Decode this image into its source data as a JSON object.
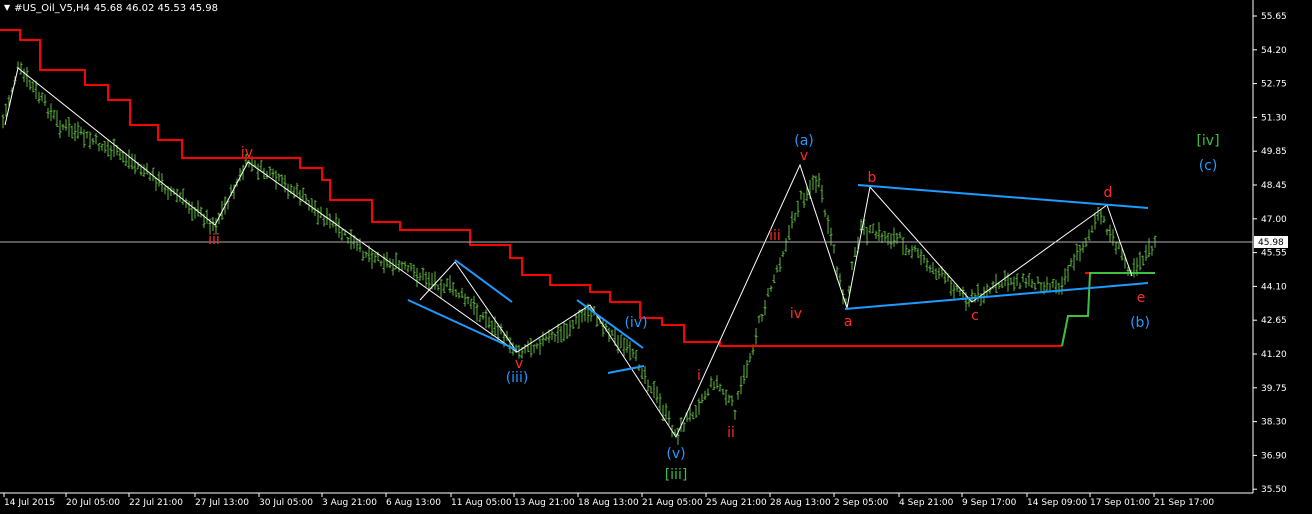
{
  "header": {
    "dropdown_glyph": "▼",
    "symbol": "#US_Oil_V5,H4",
    "ohlc": "45.68 46.02 45.53 45.98"
  },
  "colors": {
    "background": "#000000",
    "bars": "#5eb83b",
    "axis": "#ffffff",
    "red_line": "#ff0000",
    "green_line": "#3fbf3f",
    "wave_white": "#ffffff",
    "channel_blue": "#1e9bff",
    "label_red": "#ff2a2a",
    "label_blue": "#1e9bff",
    "label_green": "#3fbf3f",
    "price_line": "#b0b0b0",
    "price_box_bg": "#ffffff",
    "price_box_fg": "#000000"
  },
  "price_axis": {
    "ticks": [
      "55.65",
      "54.20",
      "52.75",
      "51.30",
      "49.85",
      "48.45",
      "47.00",
      "45.55",
      "44.10",
      "42.65",
      "41.20",
      "39.75",
      "38.30",
      "36.90",
      "35.50"
    ],
    "current_price": "45.98"
  },
  "time_axis": {
    "ticks": [
      "14 Jul 2015",
      "20 Jul 05:00",
      "22 Jul 21:00",
      "27 Jul 13:00",
      "30 Jul 05:00",
      "3 Aug 21:00",
      "6 Aug 13:00",
      "11 Aug 05:00",
      "13 Aug 21:00",
      "18 Aug 13:00",
      "21 Aug 05:00",
      "25 Aug 21:00",
      "28 Aug 13:00",
      "2 Sep 05:00",
      "4 Sep 21:00",
      "9 Sep 17:00",
      "14 Sep 09:00",
      "17 Sep 01:00",
      "21 Sep 17:00"
    ]
  },
  "wave_labels": [
    {
      "id": "iv-top",
      "text": "iv",
      "color": "red"
    },
    {
      "id": "iii-low",
      "text": "iii",
      "color": "red"
    },
    {
      "id": "v-low",
      "text": "v",
      "color": "red"
    },
    {
      "id": "iii-paren",
      "text": "(iii)",
      "color": "blue"
    },
    {
      "id": "iv-paren",
      "text": "(iv)",
      "color": "blue"
    },
    {
      "id": "v-paren",
      "text": "(v)",
      "color": "blue"
    },
    {
      "id": "iii-bracket",
      "text": "[iii]",
      "color": "green"
    },
    {
      "id": "i-red",
      "text": "i",
      "color": "red"
    },
    {
      "id": "ii-red",
      "text": "ii",
      "color": "red"
    },
    {
      "id": "iii-red2",
      "text": "iii",
      "color": "red"
    },
    {
      "id": "iv-red2",
      "text": "iv",
      "color": "red"
    },
    {
      "id": "v-red2",
      "text": "v",
      "color": "red"
    },
    {
      "id": "a-paren",
      "text": "(a)",
      "color": "blue"
    },
    {
      "id": "a-red",
      "text": "a",
      "color": "red"
    },
    {
      "id": "b-red",
      "text": "b",
      "color": "red"
    },
    {
      "id": "c-red",
      "text": "c",
      "color": "red"
    },
    {
      "id": "d-red",
      "text": "d",
      "color": "red"
    },
    {
      "id": "e-red",
      "text": "e",
      "color": "red"
    },
    {
      "id": "b-paren",
      "text": "(b)",
      "color": "blue"
    },
    {
      "id": "iv-bracket",
      "text": "[iv]",
      "color": "green"
    },
    {
      "id": "c-paren",
      "text": "(c)",
      "color": "blue"
    }
  ]
}
